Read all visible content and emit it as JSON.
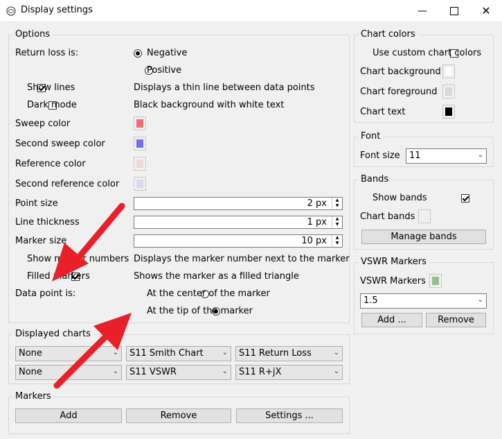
{
  "window": {
    "title": "Display settings"
  },
  "options": {
    "title": "Options",
    "return_loss_label": "Return loss is:",
    "negative_label": "Negative",
    "positive_label": "Positive",
    "show_lines_label": "Show lines",
    "show_lines_desc": "Displays a thin line between data points",
    "dark_mode_label": "Dark mode",
    "dark_mode_desc": "Black background with white text",
    "sweep_color_label": "Sweep color",
    "second_sweep_color_label": "Second sweep color",
    "reference_color_label": "Reference color",
    "second_reference_color_label": "Second reference color",
    "point_size_label": "Point size",
    "point_size_value": "2 px",
    "line_thickness_label": "Line thickness",
    "line_thickness_value": "1 px",
    "marker_size_label": "Marker size",
    "marker_size_value": "10 px",
    "show_marker_numbers_label": "Show marker numbers",
    "show_marker_numbers_desc": "Displays the marker number next to the marker",
    "filled_markers_label": "Filled markers",
    "filled_markers_desc": "Shows the marker as a filled triangle",
    "data_point_label": "Data point is:",
    "center_label": "At the center of the marker",
    "tip_label": "At the tip of the marker",
    "colors": {
      "sweep": "#f07070",
      "second_sweep": "#7070f0",
      "reference": "#f0d8d8",
      "second_reference": "#d8d8f0"
    }
  },
  "displayed_charts": {
    "title": "Displayed charts",
    "row1": [
      "None",
      "S11 Smith Chart",
      "S11 Return Loss"
    ],
    "row2": [
      "None",
      "S11 VSWR",
      "S11 R+jX"
    ]
  },
  "markers": {
    "title": "Markers",
    "add": "Add",
    "remove": "Remove",
    "settings": "Settings ..."
  },
  "chart_colors": {
    "title": "Chart colors",
    "use_custom_label": "Use custom chart colors",
    "background_label": "Chart background",
    "foreground_label": "Chart foreground",
    "text_label": "Chart text",
    "colors": {
      "background": "#ffffff",
      "foreground": "#d8d8d8",
      "text": "#000000"
    }
  },
  "font": {
    "title": "Font",
    "size_label": "Font size",
    "size_value": "11"
  },
  "bands": {
    "title": "Bands",
    "show_label": "Show bands",
    "chart_bands_label": "Chart bands",
    "manage_label": "Manage bands"
  },
  "vswr": {
    "title": "VSWR Markers",
    "label": "VSWR Markers",
    "value": "1.5",
    "add": "Add ...",
    "remove": "Remove",
    "color": "#90c090"
  },
  "annotation": {
    "arrow_color": "#e8202a"
  }
}
